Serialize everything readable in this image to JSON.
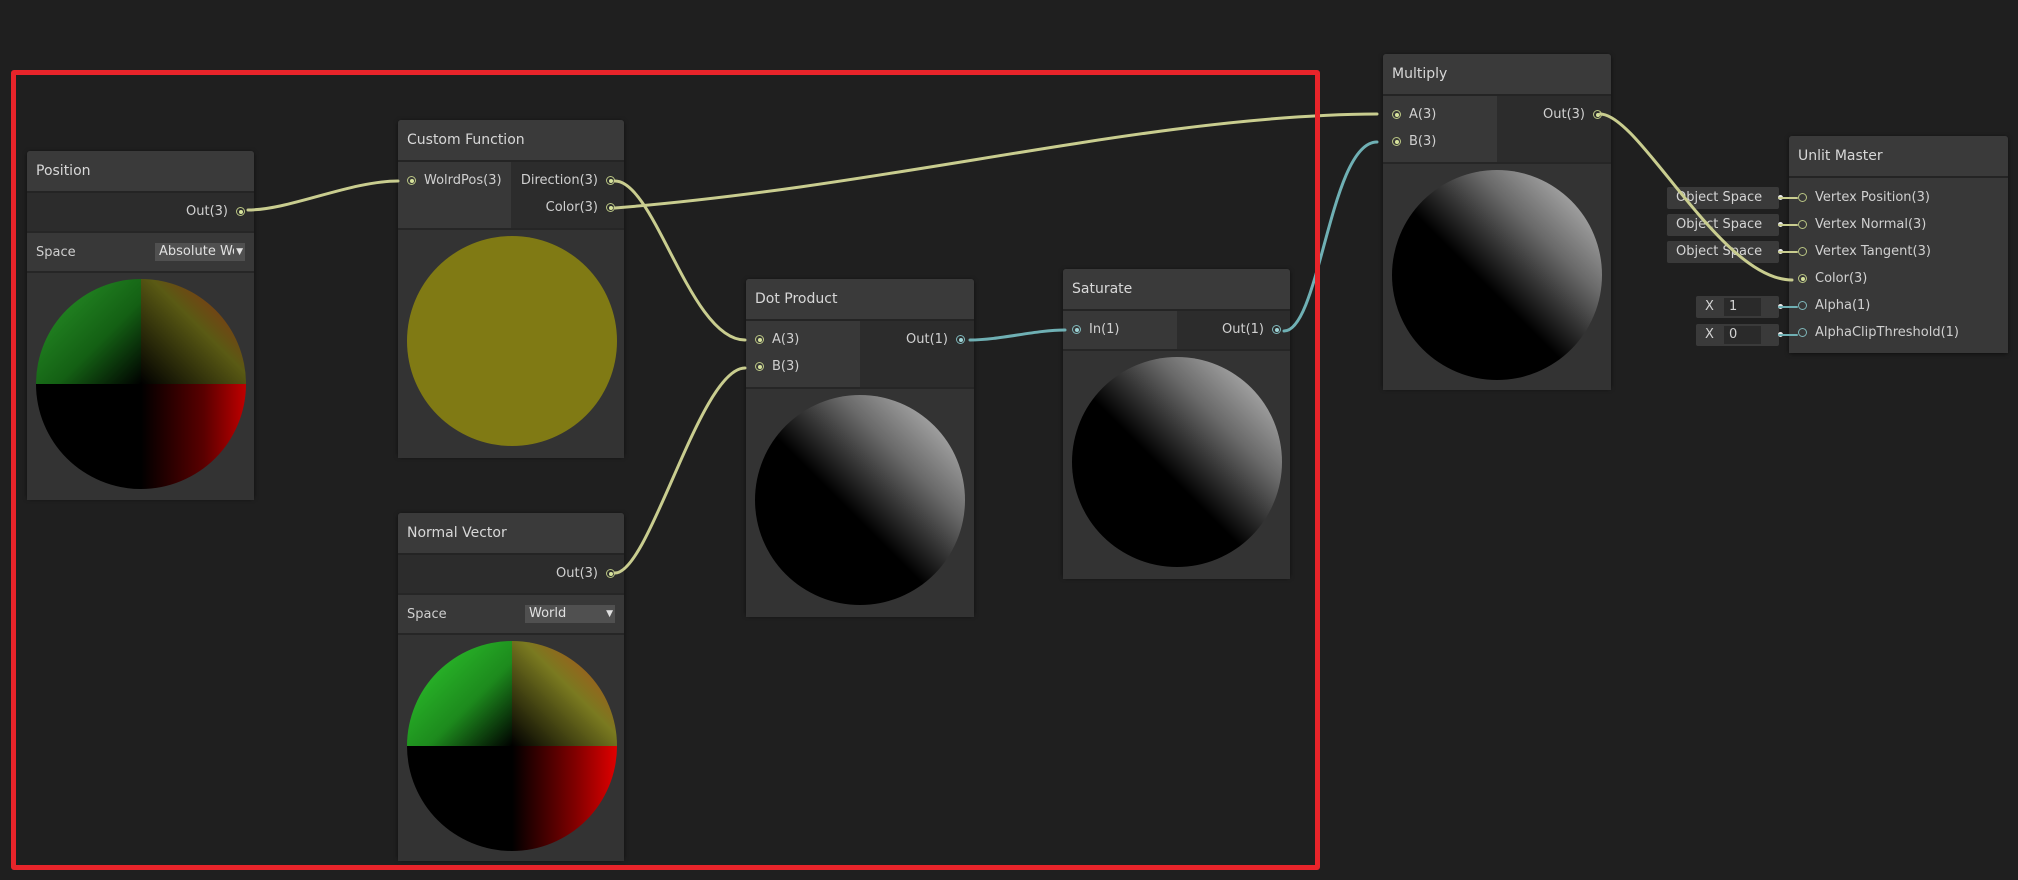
{
  "colors": {
    "background": "#1f1f1f",
    "node": "#333333",
    "wire_vector3": "#c9cd8f",
    "wire_vector1": "#6fb0b4",
    "highlight": "#e8242a",
    "custom_function_preview": "#807a14"
  },
  "nodes": {
    "position": {
      "title": "Position",
      "out": "Out(3)",
      "space_label": "Space",
      "space_value": "Absolute Wo"
    },
    "custom_function": {
      "title": "Custom Function",
      "in": "WolrdPos(3)",
      "out_direction": "Direction(3)",
      "out_color": "Color(3)"
    },
    "normal_vector": {
      "title": "Normal Vector",
      "out": "Out(3)",
      "space_label": "Space",
      "space_value": "World"
    },
    "dot_product": {
      "title": "Dot Product",
      "in_a": "A(3)",
      "in_b": "B(3)",
      "out": "Out(1)"
    },
    "saturate": {
      "title": "Saturate",
      "in": "In(1)",
      "out": "Out(1)"
    },
    "multiply": {
      "title": "Multiply",
      "in_a": "A(3)",
      "in_b": "B(3)",
      "out": "Out(3)"
    },
    "unlit_master": {
      "title": "Unlit Master",
      "inputs": [
        "Vertex Position(3)",
        "Vertex Normal(3)",
        "Vertex Tangent(3)",
        "Color(3)",
        "Alpha(1)",
        "AlphaClipThreshold(1)"
      ],
      "space_fields": [
        "Object Space",
        "Object Space",
        "Object Space"
      ],
      "alpha_x": "X",
      "alpha_value": "1",
      "clip_x": "X",
      "clip_value": "0"
    }
  }
}
